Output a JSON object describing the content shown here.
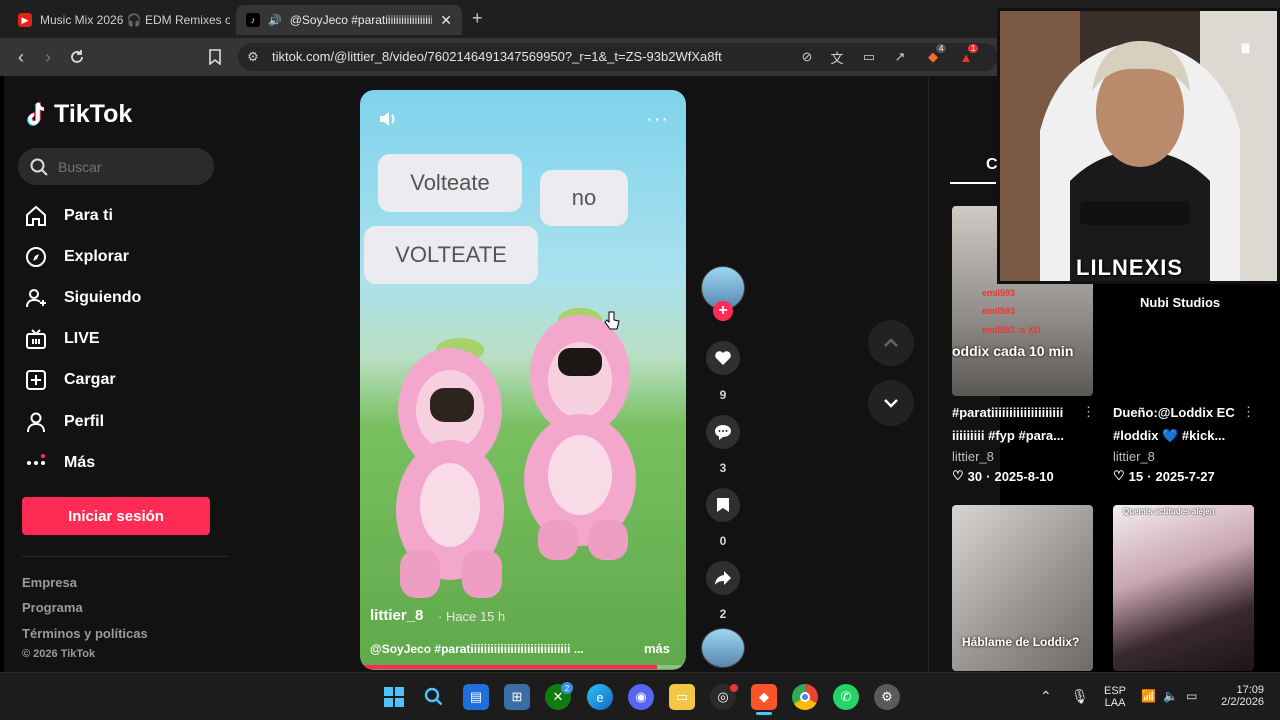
{
  "browser": {
    "tabs": [
      {
        "title": "Music Mix 2026 🎧 EDM Remixes of",
        "active": false
      },
      {
        "title": "@SoyJeco #paratiiiiiiiiiiiiiiiiii",
        "active": true
      }
    ],
    "url": "tiktok.com/@littier_8/video/7602146491347569950?_r=1&_t=ZS-93b2WfXa8ft",
    "shield_count": "4",
    "rewards_count": "1"
  },
  "sidebar": {
    "brand": "TikTok",
    "search_placeholder": "Buscar",
    "nav": [
      {
        "label": "Para ti",
        "icon": "home-icon"
      },
      {
        "label": "Explorar",
        "icon": "compass-icon"
      },
      {
        "label": "Siguiendo",
        "icon": "following-icon"
      },
      {
        "label": "LIVE",
        "icon": "live-icon"
      },
      {
        "label": "Cargar",
        "icon": "upload-icon"
      },
      {
        "label": "Perfil",
        "icon": "profile-icon"
      },
      {
        "label": "Más",
        "icon": "more-icon"
      }
    ],
    "login_label": "Iniciar sesión",
    "footer": [
      "Empresa",
      "Programa",
      "Términos y políticas"
    ],
    "copyright": "© 2026 TikTok"
  },
  "video": {
    "bubbles": [
      "Volteate",
      "no",
      "VOLTEATE"
    ],
    "author": "littier_8",
    "time_ago": "· Hace 15 h",
    "caption": "@SoyJeco #paratiiiiiiiiiiiiiiiiiiiiiiiiiiiiii ...",
    "more_label": "más",
    "progress_fraction": 0.91
  },
  "actions": {
    "likes": "9",
    "comments": "3",
    "saves": "0",
    "shares": "2"
  },
  "right_panel": {
    "heading_partial": "C",
    "cards": [
      {
        "thumb_text": "oddix cada 10 min",
        "title": "#paratiiiiiiiiiiiiiiiiiiii",
        "title2": "iiiiiiiii #fyp #para...",
        "author": "littier_8",
        "likes": "30",
        "date": "2025-8-10"
      },
      {
        "thumb_text": "",
        "title": "Dueño:@Loddix EC",
        "title2": "#loddix 💙 #kick...",
        "author": "littier_8",
        "likes": "15",
        "date": "2025-7-27"
      },
      {
        "thumb_text": "Háblame de Loddix?",
        "title": "",
        "title2": "",
        "author": "",
        "likes": "",
        "date": ""
      },
      {
        "thumb_text": "Quemis actitudes alejen",
        "title": "",
        "title2": "",
        "author": "",
        "likes": "",
        "date": ""
      }
    ],
    "chat_lines": [
      "emil593",
      "emil593",
      "emil593 :s XD"
    ],
    "studio_label": "Nubi Studios"
  },
  "webcam": {
    "name": "LILNEXIS"
  },
  "taskbar": {
    "lang_top": "ESP",
    "lang_bottom": "LAA",
    "time": "17:09",
    "date": "2/2/2026",
    "xbox_badge": "2"
  }
}
